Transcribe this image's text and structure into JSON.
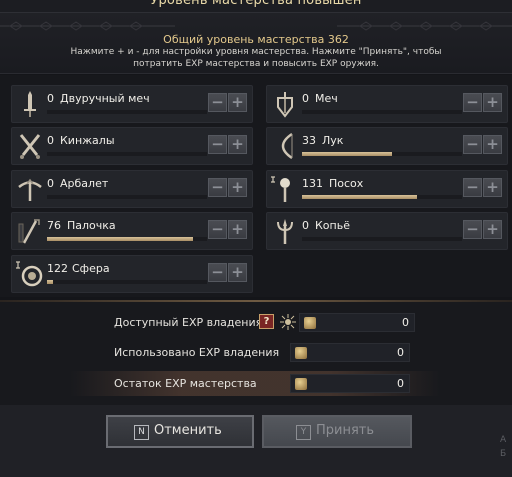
{
  "window": {
    "title": "Уровень мастерства повышен"
  },
  "header": {
    "total_label": "Общий уровень мастерства 362",
    "hint_line1": "Нажмите + и - для настройки уровня мастерства. Нажмите \"Принять\", чтобы",
    "hint_line2": "потратить EXP мастерства и повысить EXP оружия."
  },
  "weapons": [
    {
      "level": "0",
      "name": "Двуручный меч",
      "progress": 0.0,
      "icon": "greatsword-icon"
    },
    {
      "level": "0",
      "name": "Меч",
      "progress": 0.0,
      "icon": "sword-shield-icon"
    },
    {
      "level": "0",
      "name": "Кинжалы",
      "progress": 0.0,
      "icon": "daggers-icon"
    },
    {
      "level": "33",
      "name": "Лук",
      "progress": 0.56,
      "icon": "bow-icon"
    },
    {
      "level": "0",
      "name": "Арбалет",
      "progress": 0.0,
      "icon": "crossbow-icon"
    },
    {
      "level": "131",
      "name": "Посох",
      "progress": 0.72,
      "icon": "staff-icon"
    },
    {
      "level": "76",
      "name": "Палочка",
      "progress": 0.91,
      "icon": "wand-icon"
    },
    {
      "level": "0",
      "name": "Копьё",
      "progress": 0.0,
      "icon": "spear-icon"
    },
    {
      "level": "122",
      "name": "Сфера",
      "progress": 0.04,
      "icon": "orb-icon"
    }
  ],
  "buttons": {
    "minus": "−",
    "plus": "+"
  },
  "stats": {
    "available_label": "Доступный EXP владения",
    "help": "?",
    "available_value": "0",
    "used_label": "Использовано EXP владения",
    "used_value": "0",
    "remaining_label": "Остаток EXP мастерства",
    "remaining_value": "0"
  },
  "footer": {
    "cancel_key": "N",
    "cancel_label": "Отменить",
    "accept_key": "Y",
    "accept_label": "Принять",
    "edge_glyph1": "A",
    "edge_glyph2": "Б"
  },
  "colors": {
    "accent": "#e4c98c",
    "progress_fill": "#cbb48b",
    "help_badge": "#7a2624"
  }
}
